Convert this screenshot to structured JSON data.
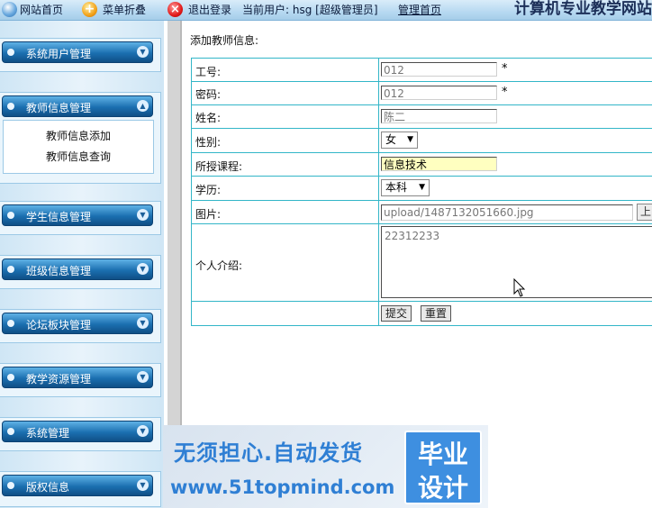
{
  "topbar": {
    "home": "网站首页",
    "menu_fold": "菜单折叠",
    "logout": "退出登录",
    "current_user": "当前用户: hsg [超级管理员]",
    "admin_home": "管理首页",
    "site_title": "计算机专业教学网站"
  },
  "sidebar": {
    "items": [
      {
        "label": "系统用户管理"
      },
      {
        "label": "教师信息管理",
        "sub": [
          "教师信息添加",
          "教师信息查询"
        ]
      },
      {
        "label": "学生信息管理"
      },
      {
        "label": "班级信息管理"
      },
      {
        "label": "论坛板块管理"
      },
      {
        "label": "教学资源管理"
      },
      {
        "label": "系统管理"
      },
      {
        "label": "版权信息"
      }
    ]
  },
  "main": {
    "breadcrumb": "添加教师信息:",
    "form": {
      "emp_no_label": "工号:",
      "emp_no_value": "012",
      "password_label": "密码:",
      "password_value": "012",
      "name_label": "姓名:",
      "name_value": "陈二",
      "gender_label": "性别:",
      "gender_value": "女",
      "course_label": "所授课程:",
      "course_value": "信息技术",
      "education_label": "学历:",
      "education_value": "本科",
      "photo_label": "图片:",
      "photo_value": "upload/1487132051660.jpg",
      "upload_label": "上",
      "intro_label": "个人介绍:",
      "intro_value": "22312233",
      "required_mark": "*",
      "submit_label": "提交",
      "reset_label": "重置"
    }
  },
  "watermark": {
    "line1": "无须担心.自动发货",
    "line2": "www.51topmind.com",
    "badge1": "毕业",
    "badge2": "设计"
  }
}
